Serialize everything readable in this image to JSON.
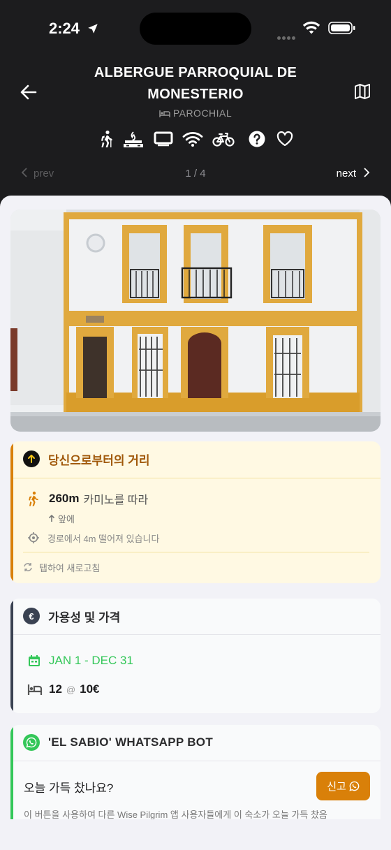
{
  "status_bar": {
    "time": "2:24"
  },
  "header": {
    "title": "ALBERGUE PARROQUIAL DE MONESTERIO",
    "type_label": "PAROCHIAL",
    "amenities": [
      "hiker-icon",
      "kitchen-icon",
      "tv-icon",
      "wifi-icon",
      "bicycle-icon",
      "help-icon",
      "heart-icon"
    ]
  },
  "pager": {
    "prev_label": "prev",
    "count_label": "1 / 4",
    "next_label": "next"
  },
  "distance_card": {
    "title": "당신으로부터의 거리",
    "distance_value": "260m",
    "distance_text": "카미노를 따라",
    "direction_text": "앞에",
    "offroute_text": "경로에서 4m 떨어져 있습니다",
    "refresh_text": "탭하여 새로고침",
    "accent_color": "#d98009"
  },
  "availability_card": {
    "title": "가용성 및 가격",
    "dates": "JAN 1 - DEC 31",
    "beds": "12",
    "at_symbol": "@",
    "price": "10€",
    "date_color": "#34c759"
  },
  "whatsapp_card": {
    "title": "'EL SABIO' WHATSAPP BOT",
    "question": "오늘 가득 찼나요?",
    "report_button": "신고",
    "description": "이 버튼을 사용하여 다른 Wise Pilgrim 앱 사용자들에게 이 숙소가 오늘 가득 찼음"
  }
}
